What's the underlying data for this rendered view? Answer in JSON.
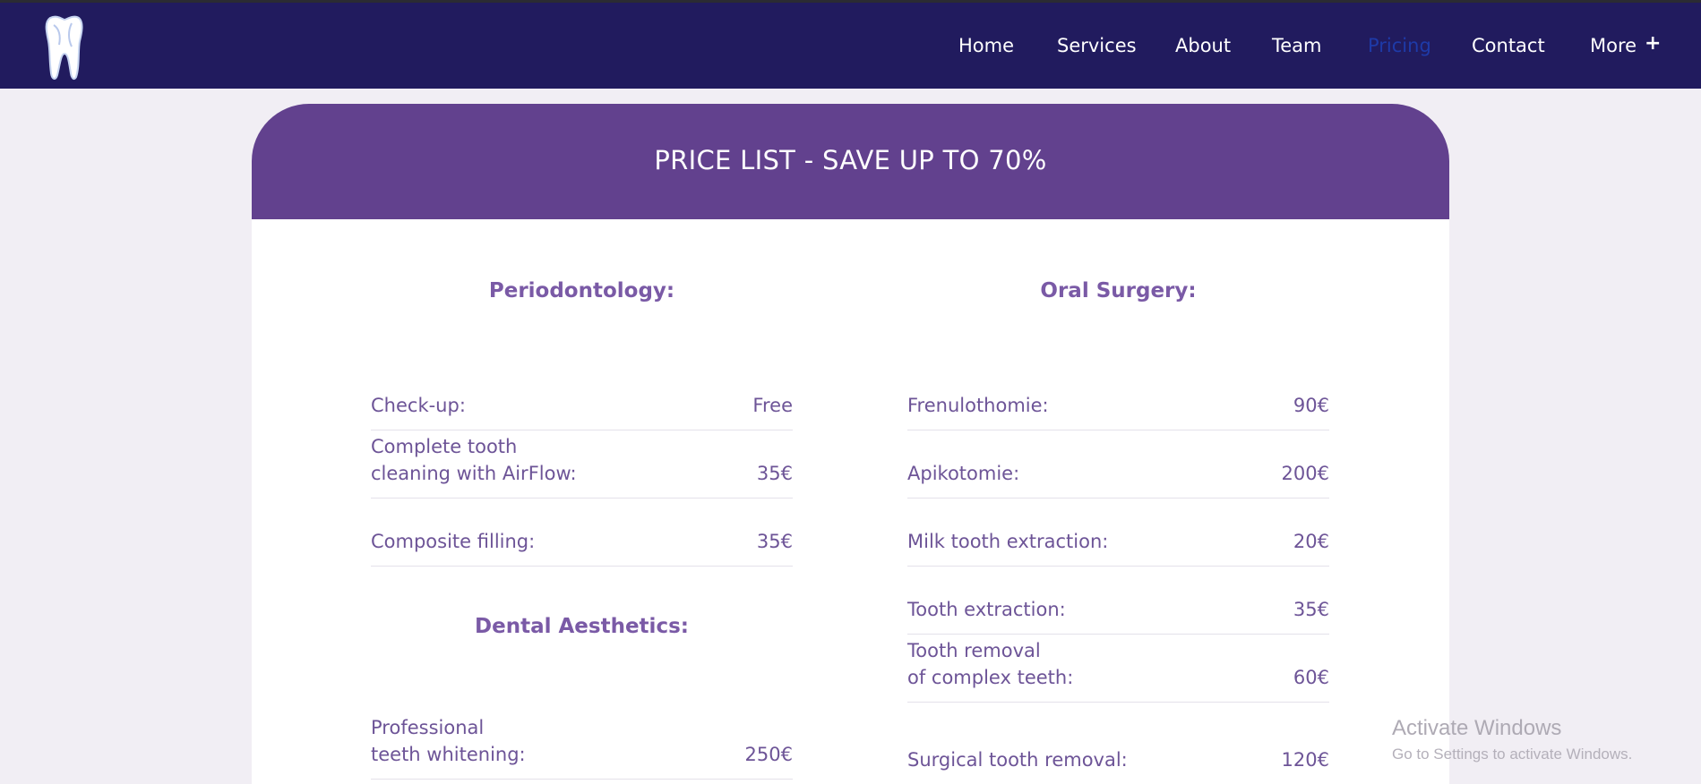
{
  "nav": {
    "logo": "tooth-logo",
    "items": [
      {
        "label": "Home"
      },
      {
        "label": "Services"
      },
      {
        "label": "About"
      },
      {
        "label": "Team"
      },
      {
        "label": "Pricing",
        "active": true
      },
      {
        "label": "Contact"
      },
      {
        "label": "More"
      }
    ],
    "more_expand": "+"
  },
  "pricing": {
    "title": "PRICE LIST - SAVE UP TO 70%",
    "periodontology": {
      "heading": "Periodontology:",
      "items": [
        {
          "label": "Check-up:",
          "price": "Free"
        },
        {
          "label_line1": "Complete tooth",
          "label_line2": "cleaning with AirFlow:",
          "price": "35€"
        },
        {
          "label": "Composite filling:",
          "price": "35€"
        }
      ]
    },
    "aesthetics": {
      "heading": "Dental Aesthetics:",
      "items": [
        {
          "label_line1": "Professional",
          "label_line2": "teeth whitening:",
          "price": "250€"
        }
      ]
    },
    "oral_surgery": {
      "heading": "Oral Surgery:",
      "items": [
        {
          "label": "Frenulothomie:",
          "price": "90€"
        },
        {
          "label": "Apikotomie:",
          "price": "200€"
        },
        {
          "label": "Milk tooth extraction:",
          "price": "20€"
        },
        {
          "label": "Tooth extraction:",
          "price": "35€"
        },
        {
          "label_line1": "Tooth removal",
          "label_line2": "of complex teeth:",
          "price": "60€"
        },
        {
          "label": "Surgical tooth removal:",
          "price": "120€"
        }
      ]
    }
  },
  "watermark": {
    "title": "Activate Windows",
    "subtitle": "Go to Settings to activate Windows."
  },
  "colors": {
    "navbar": "#211b5e",
    "card_header": "#62418e",
    "text_purple": "#6d5497",
    "active_link": "#1e3aa8"
  }
}
